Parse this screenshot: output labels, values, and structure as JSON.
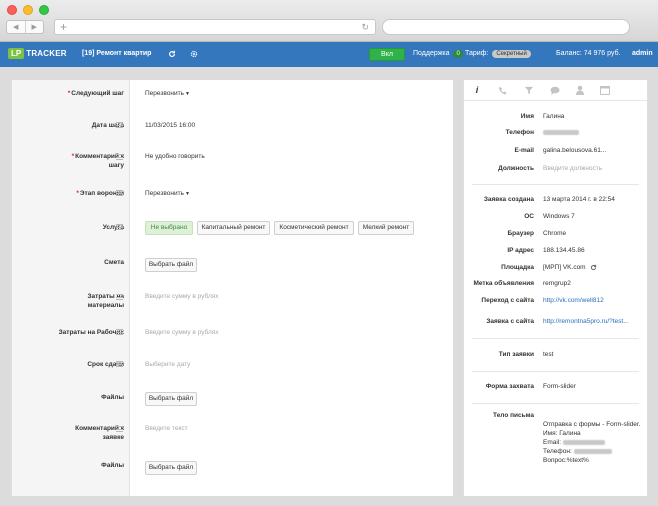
{
  "browser": {
    "back": "◀",
    "forward": "▶",
    "new_tab": "+",
    "reload": "↻"
  },
  "app": {
    "logo_lp": "LP",
    "logo_tracker": "TRACKER",
    "project_title": "[19] Ремонт квартир",
    "on_button": "Вкл",
    "support_label": "Поддержка",
    "support_count": "0",
    "tarif_label": "Тариф:",
    "tarif_value": "Секретный",
    "balance": "Баланс: 74 976 руб.",
    "user": "admin"
  },
  "form": {
    "next_step": {
      "label": "Следующий шаг",
      "value": "Перезвонить"
    },
    "step_date": {
      "label": "Дата шага",
      "value": "11/03/2015 16:00"
    },
    "step_comment": {
      "label_1": "Комментарий к",
      "label_2": "шагу",
      "value": "Не удобно говорить"
    },
    "funnel_stage": {
      "label": "Этап воронки",
      "value": "Перезвонить"
    },
    "service": {
      "label": "Услуга",
      "options": [
        "Не выбрано",
        "Капитальный ремонт",
        "Косметический ремонт",
        "Мелкий ремонт"
      ]
    },
    "estimate": {
      "label": "Смета",
      "button": "Выбрать файл"
    },
    "materials_cost": {
      "label_1": "Затраты на",
      "label_2": "материалы",
      "placeholder": "Введите сумму в рублях"
    },
    "workers_cost": {
      "label": "Затраты на Рабочих",
      "placeholder": "Введите сумму в рублях"
    },
    "deadline": {
      "label": "Срок сдачи",
      "placeholder": "Выберите дату"
    },
    "files_1": {
      "label": "Файлы",
      "button": "Выбрать файл"
    },
    "request_comment": {
      "label_1": "Комментарий к",
      "label_2": "заявке",
      "placeholder": "Введите текст"
    },
    "files_2": {
      "label": "Файлы",
      "button": "Выбрать файл"
    }
  },
  "details": {
    "tabs": [
      "info-icon",
      "phone-icon",
      "filter-icon",
      "chat-icon",
      "user-icon",
      "calendar-icon"
    ],
    "name": {
      "label": "Имя",
      "value": "Галина"
    },
    "phone": {
      "label": "Телефон"
    },
    "email": {
      "label": "E-mail",
      "value": "galina.belousova.61..."
    },
    "position": {
      "label": "Должность",
      "placeholder": "Введите должность"
    },
    "created": {
      "label": "Заявка создана",
      "value": "13 марта 2014 г. в 22:54"
    },
    "os": {
      "label": "ОС",
      "value": "Windows 7"
    },
    "browser": {
      "label": "Браузер",
      "value": "Chrome"
    },
    "ip": {
      "label": "IP адрес",
      "value": "188.134.45.86"
    },
    "platform": {
      "label": "Площадка",
      "value": "[МРП] VK.com"
    },
    "ad_tag": {
      "label": "Метка объявления",
      "value": "remgrup2"
    },
    "from_site": {
      "label": "Переход с сайта",
      "value": "http://vk.com/well812"
    },
    "request_site": {
      "label": "Заявка с сайта",
      "value": "http://remontna5pro.ru/?test..."
    },
    "request_type": {
      "label": "Тип заявки",
      "value": "test"
    },
    "capture_form": {
      "label": "Форма захвата",
      "value": "Form-slider"
    },
    "letter_body": {
      "label": "Тело письма",
      "lines": [
        "Отправка с формы - Form-slider.",
        "Имя: Галина",
        "Email:",
        "Телефон:",
        "Вопрос:%text%"
      ]
    }
  }
}
